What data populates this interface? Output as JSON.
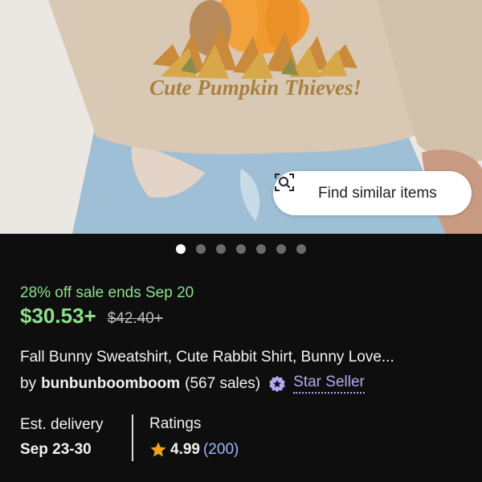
{
  "product_image": {
    "print_text": "Cute Pumpkin Thieves!"
  },
  "find_similar": {
    "label": "Find similar items",
    "icon": "camera-search-icon"
  },
  "carousel": {
    "total": 7,
    "active_index": 0
  },
  "sale": {
    "text": "28% off sale ends Sep 20"
  },
  "price": {
    "current": "$30.53+",
    "original": "$42.40+"
  },
  "listing": {
    "title": "Fall Bunny Sweatshirt, Cute Rabbit Shirt, Bunny Love..."
  },
  "seller": {
    "by": "by",
    "name": "bunbunboomboom",
    "sales": "(567 sales)",
    "badge_icon": "star-seller-badge-icon",
    "badge_label": "Star Seller"
  },
  "delivery": {
    "label": "Est. delivery",
    "value": "Sep 23-30"
  },
  "ratings": {
    "label": "Ratings",
    "score": "4.99",
    "count": "(200)",
    "star_icon": "star-icon"
  },
  "colors": {
    "background": "#0e0e0e",
    "sale_green": "#8ee08e",
    "star_seller_purple": "#b9a6f2",
    "count_blue": "#9fb6ff",
    "star_orange": "#f0a21b"
  }
}
